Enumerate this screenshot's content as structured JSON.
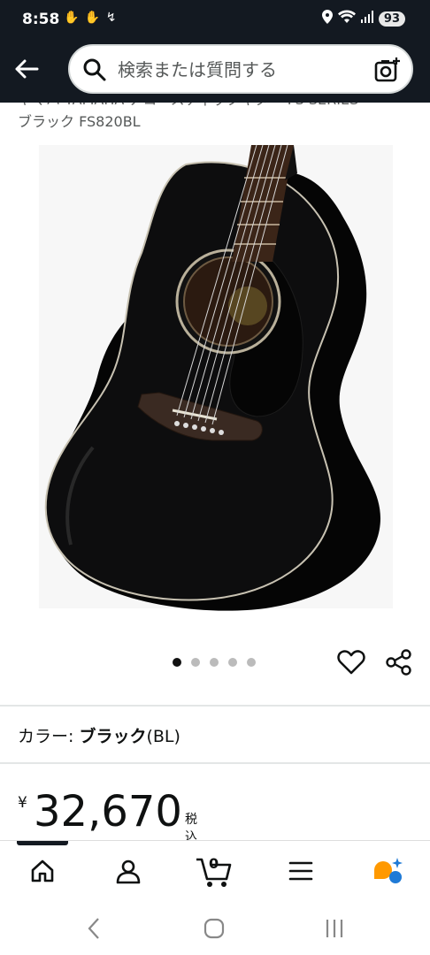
{
  "status_bar": {
    "time": "8:58",
    "battery": "93"
  },
  "search": {
    "placeholder": "検索または質問する"
  },
  "product": {
    "title_line1": "ヤマハ YAMAHA アコースティックギター FS SERIES",
    "title_line2": "ブラック FS820BL",
    "image_dots_count": 5,
    "image_dots_active": 0
  },
  "color": {
    "label": "カラー: ",
    "value": "ブラック",
    "suffix": "(BL)"
  },
  "price": {
    "currency": "¥",
    "amount": "32,670",
    "tax_note": "税込"
  },
  "bottom_nav": {
    "cart_count": "0"
  },
  "colors": {
    "header_bg": "#131921",
    "accent_orange": "#ff9900"
  }
}
